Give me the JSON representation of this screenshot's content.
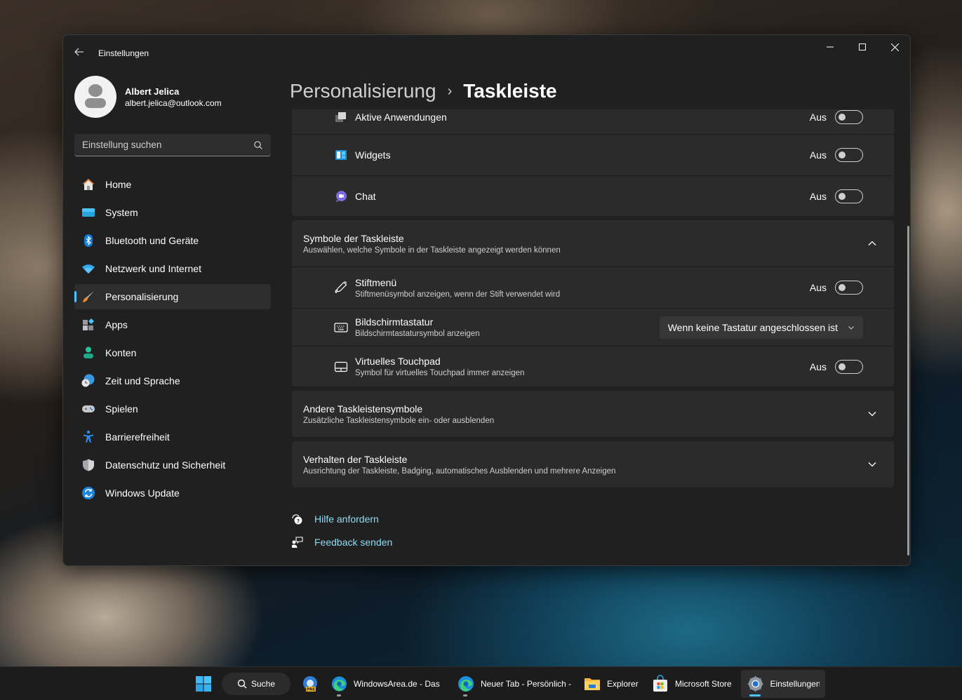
{
  "window": {
    "app_title": "Einstellungen",
    "controls": {
      "minimize": "minimize",
      "maximize": "maximize",
      "close": "close"
    }
  },
  "profile": {
    "name": "Albert Jelica",
    "email": "albert.jelica@outlook.com"
  },
  "search": {
    "placeholder": "Einstellung suchen",
    "value": ""
  },
  "sidebar": {
    "items": [
      {
        "label": "Home",
        "icon": "home-icon",
        "active": false
      },
      {
        "label": "System",
        "icon": "system-icon",
        "active": false
      },
      {
        "label": "Bluetooth und Geräte",
        "icon": "bluetooth-icon",
        "active": false
      },
      {
        "label": "Netzwerk und Internet",
        "icon": "wifi-icon",
        "active": false
      },
      {
        "label": "Personalisierung",
        "icon": "brush-icon",
        "active": true
      },
      {
        "label": "Apps",
        "icon": "apps-icon",
        "active": false
      },
      {
        "label": "Konten",
        "icon": "person-icon",
        "active": false
      },
      {
        "label": "Zeit und Sprache",
        "icon": "globe-clock-icon",
        "active": false
      },
      {
        "label": "Spielen",
        "icon": "gamepad-icon",
        "active": false
      },
      {
        "label": "Barrierefreiheit",
        "icon": "accessibility-icon",
        "active": false
      },
      {
        "label": "Datenschutz und Sicherheit",
        "icon": "shield-icon",
        "active": false
      },
      {
        "label": "Windows Update",
        "icon": "update-icon",
        "active": false
      }
    ]
  },
  "breadcrumb": {
    "parent": "Personalisierung",
    "separator": "›",
    "current": "Taskleiste"
  },
  "taskbar_items_card": {
    "rows": [
      {
        "title": "Aktive Anwendungen",
        "value": "Aus",
        "on": false,
        "icon": "task-view-icon"
      },
      {
        "title": "Widgets",
        "value": "Aus",
        "on": false,
        "icon": "widgets-icon"
      },
      {
        "title": "Chat",
        "value": "Aus",
        "on": false,
        "icon": "chat-icon"
      }
    ]
  },
  "symbols_section": {
    "title": "Symbole der Taskleiste",
    "description": "Auswählen, welche Symbole in der Taskleiste angezeigt werden können",
    "expanded": true,
    "rows": [
      {
        "title": "Stiftmenü",
        "description": "Stiftmenüsymbol anzeigen, wenn der Stift verwendet wird",
        "value": "Aus",
        "on": false,
        "icon": "pen-icon"
      },
      {
        "title": "Bildschirmtastatur",
        "description": "Bildschirmtastatursymbol anzeigen",
        "dropdown": "Wenn keine Tastatur angeschlossen ist",
        "icon": "keyboard-icon"
      },
      {
        "title": "Virtuelles Touchpad",
        "description": "Symbol für virtuelles Touchpad immer anzeigen",
        "value": "Aus",
        "on": false,
        "icon": "touchpad-icon"
      }
    ]
  },
  "other_symbols_section": {
    "title": "Andere Taskleistensymbole",
    "description": "Zusätzliche Taskleistensymbole ein- oder ausblenden",
    "expanded": false
  },
  "behavior_section": {
    "title": "Verhalten der Taskleiste",
    "description": "Ausrichtung der Taskleiste, Badging, automatisches Ausblenden und mehrere Anzeigen",
    "expanded": false
  },
  "links": {
    "help": "Hilfe anfordern",
    "feedback": "Feedback senden"
  },
  "taskbar": {
    "search_label": "Suche",
    "items": [
      {
        "label": "",
        "icon": "edge-dev-icon",
        "badge": "PRE"
      },
      {
        "label": "WindowsArea.de - Das W",
        "icon": "edge-icon"
      },
      {
        "label": "Neuer Tab - Persönlich -",
        "icon": "edge-icon"
      },
      {
        "label": "Explorer",
        "icon": "folder-icon"
      },
      {
        "label": "Microsoft Store",
        "icon": "store-icon"
      },
      {
        "label": "Einstellungen",
        "icon": "settings-gear-icon",
        "active": true
      }
    ]
  },
  "colors": {
    "accent": "#4cc2ff",
    "link": "#8fdcf5",
    "window_bg": "#202020",
    "card_bg": "#2b2b2b"
  }
}
